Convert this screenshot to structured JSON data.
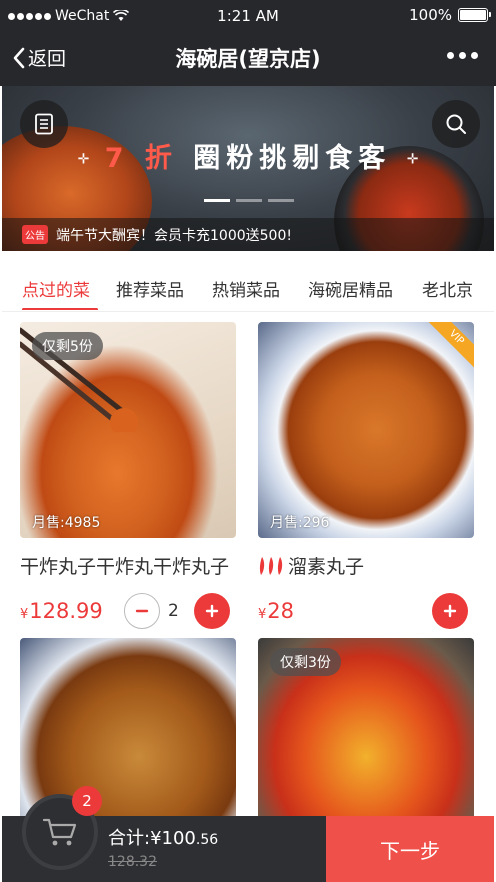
{
  "status_bar": {
    "carrier": "WeChat",
    "time": "1:21 AM",
    "battery": "100%"
  },
  "nav": {
    "back_label": "返回",
    "title": "海碗居(望京店)"
  },
  "banner": {
    "promo_highlight": "7 折",
    "promo_text": "圈粉挑剔食客",
    "notice_tag": "公告",
    "notice_text": "端午节大酬宾！会员卡充1000送500!"
  },
  "tabs": [
    "点过的菜",
    "推荐菜品",
    "热销菜品",
    "海碗居精品",
    "老北京"
  ],
  "active_tab": "点过的菜",
  "dishes": [
    {
      "name": "干炸丸子干炸丸干炸丸子",
      "currency": "¥",
      "price": "128.99",
      "badge": "仅剩5份",
      "monthly": "月售:4985",
      "quantity": "2",
      "vip": ""
    },
    {
      "name": "溜素丸子",
      "currency": "¥",
      "price": "28",
      "badge": "",
      "monthly": "月售:296",
      "quantity": "",
      "vip": "VIP",
      "spicy": true
    },
    {
      "name": "",
      "badge": ""
    },
    {
      "name": "",
      "badge": "仅剩3份"
    }
  ],
  "cart": {
    "count": "2",
    "total_label": "合计:¥100",
    "total_cents": ".56",
    "original": "128.32",
    "next_label": "下一步"
  },
  "colors": {
    "accent": "#ec3a3a",
    "nav_bg": "#27282c",
    "cart_bg": "#2e2f33",
    "next_bg": "#f0504a"
  }
}
